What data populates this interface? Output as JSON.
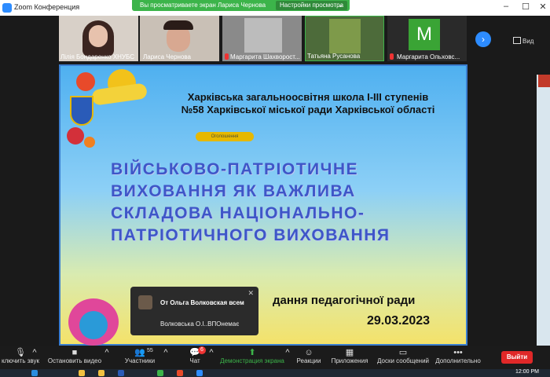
{
  "window": {
    "title": "Zoom Конференция",
    "share_banner_text": "Вы просматриваете экран Лариса Чернова",
    "view_settings": "Настройки просмотра",
    "controls": [
      "–",
      "☐",
      "✕"
    ]
  },
  "gallery": {
    "participants": [
      {
        "name": "Лілія Бондаренко ХНУБС"
      },
      {
        "name": "Лариса Чернова"
      },
      {
        "name": "Маргарита Шахворост..."
      },
      {
        "name": "Татьяна Русанова"
      },
      {
        "name": "Маргарита Ольховс...",
        "initial": "M"
      }
    ],
    "view_label": "Вид"
  },
  "slide": {
    "school": "Харківська загальноосвітня школа І-ІІІ ступенів №58 Харківської міської ради Харківської області",
    "tag": "Оголошення",
    "title": "ВІЙСЬКОВО-ПАТРІОТИЧНЕ ВИХОВАННЯ ЯК ВАЖЛИВА СКЛАДОВА НАЦІОНАЛЬНО-ПАТРІОТИЧНОГО ВИХОВАННЯ",
    "meeting_partial": "дання педагогічної ради",
    "date": "29.03.2023"
  },
  "chat_toast": {
    "from": "От Ольга Волковская всем",
    "message": "Волковська О.І..ВПОнемає"
  },
  "toolbar": {
    "mute": "ключить звук",
    "video": "Остановить видео",
    "participants": "Участники",
    "participants_count": "55",
    "chat": "Чат",
    "chat_badge": "6",
    "share": "Демонстрация экрана",
    "reactions": "Реакции",
    "apps": "Приложения",
    "whiteboards": "Доски сообщений",
    "more": "Дополнительно",
    "leave": "Выйти"
  },
  "taskbar": {
    "time": "12:00 PM"
  },
  "colors": {
    "share_green": "#3cb44a",
    "zoom_blue": "#2d8cff",
    "leave_red": "#e02828",
    "slide_title_blue": "#3e56c8"
  }
}
